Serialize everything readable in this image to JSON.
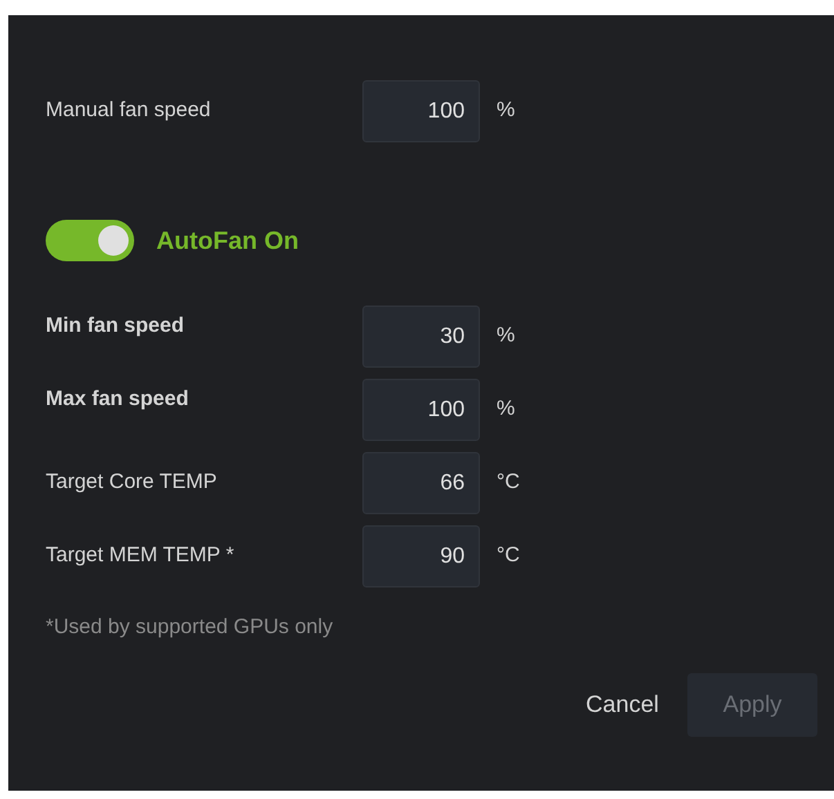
{
  "manual": {
    "label": "Manual fan speed",
    "value": "100",
    "unit": "%"
  },
  "autofan": {
    "label": "AutoFan On",
    "on": true
  },
  "settings": [
    {
      "label": "Min fan speed",
      "bold": true,
      "value": "30",
      "unit": "%"
    },
    {
      "label": "Max fan speed",
      "bold": true,
      "value": "100",
      "unit": "%"
    },
    {
      "label": "Target Core TEMP",
      "bold": false,
      "value": "66",
      "unit": "°C"
    },
    {
      "label": "Target MEM TEMP  *",
      "bold": false,
      "value": "90",
      "unit": "°C"
    }
  ],
  "footnote": "*Used by supported GPUs only",
  "buttons": [
    {
      "label": "Cancel",
      "kind": "text",
      "disabled": false
    },
    {
      "label": "Apply",
      "kind": "filled",
      "disabled": true
    }
  ]
}
